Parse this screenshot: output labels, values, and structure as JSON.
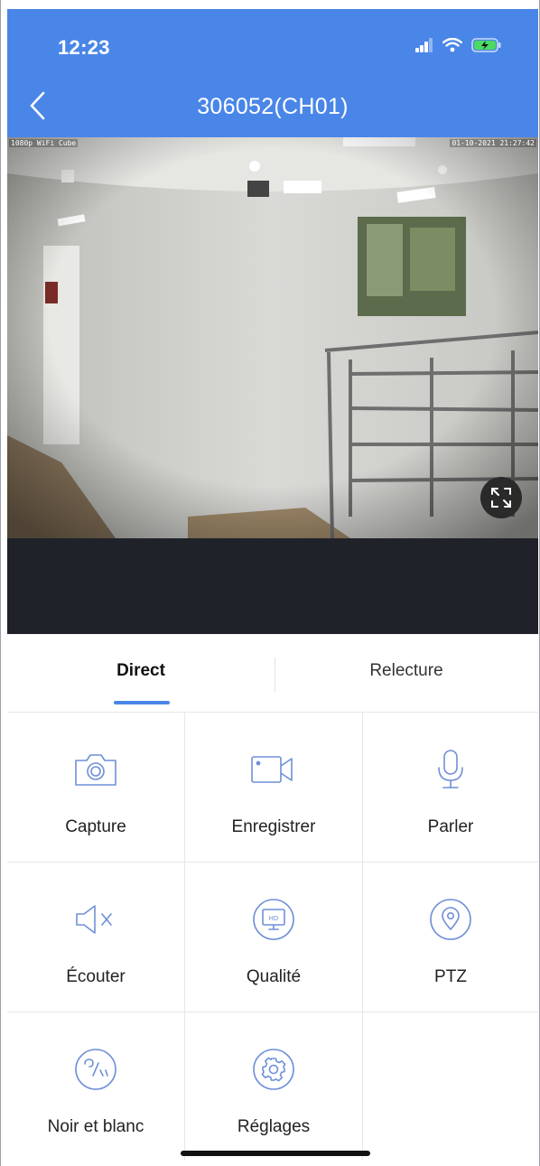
{
  "status_bar": {
    "time": "12:23"
  },
  "nav": {
    "title": "306052(CH01)",
    "back_icon": "chevron-left-icon"
  },
  "video": {
    "osd_left": "1080p WiFi Cube",
    "osd_right": "01-10-2021 21:27:42",
    "fullscreen_icon": "expand-icon"
  },
  "tabs": [
    {
      "label": "Direct",
      "active": true
    },
    {
      "label": "Relecture",
      "active": false
    }
  ],
  "controls": [
    {
      "label": "Capture",
      "icon": "camera-icon"
    },
    {
      "label": "Enregistrer",
      "icon": "video-record-icon"
    },
    {
      "label": "Parler",
      "icon": "microphone-icon"
    },
    {
      "label": "Écouter",
      "icon": "speaker-muted-icon"
    },
    {
      "label": "Qualité",
      "icon": "hd-quality-icon"
    },
    {
      "label": "PTZ",
      "icon": "location-pin-icon"
    },
    {
      "label": "Noir et blanc",
      "icon": "black-white-icon"
    },
    {
      "label": "Réglages",
      "icon": "gear-icon"
    }
  ],
  "colors": {
    "accent": "#4a86e8",
    "icon": "#6f8fd8",
    "video_bg": "#1f2329"
  }
}
